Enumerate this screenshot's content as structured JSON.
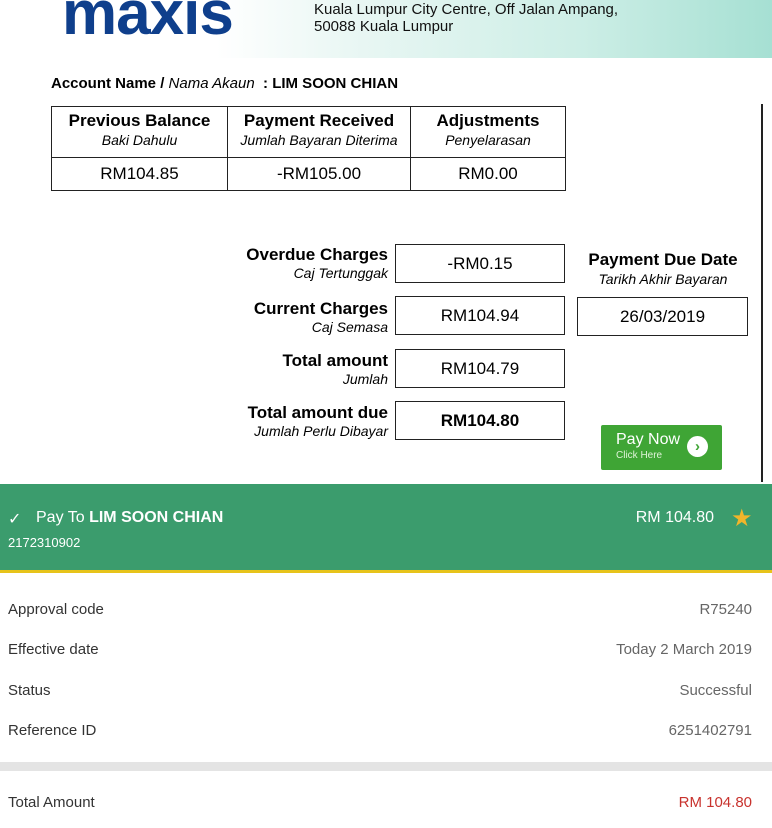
{
  "bill": {
    "logo": "maxis",
    "address_line1": "Kuala Lumpur City Centre, Off Jalan Ampang,",
    "address_line2": "50088 Kuala Lumpur",
    "account_label_en": "Account Name /",
    "account_label_ms": "Nama Akaun",
    "account_name": ": LIM SOON CHIAN",
    "balance_table": [
      {
        "title": "Previous Balance",
        "subtitle": "Baki Dahulu",
        "value": "RM104.85"
      },
      {
        "title": "Payment Received",
        "subtitle": "Jumlah Bayaran Diterima",
        "value": "-RM105.00"
      },
      {
        "title": "Adjustments",
        "subtitle": "Penyelarasan",
        "value": "RM0.00"
      }
    ],
    "charges": [
      {
        "title": "Overdue Charges",
        "subtitle": "Caj Tertunggak",
        "value": "-RM0.15"
      },
      {
        "title": "Current Charges",
        "subtitle": "Caj Semasa",
        "value": "RM104.94"
      },
      {
        "title": "Total amount",
        "subtitle": "Jumlah",
        "value": "RM104.79"
      },
      {
        "title": "Total amount due",
        "subtitle": "Jumlah Perlu Dibayar",
        "value": "RM104.80"
      }
    ],
    "due_date_title": "Payment Due Date",
    "due_date_subtitle": "Tarikh Akhir Bayaran",
    "due_date": "26/03/2019",
    "pay_now_label": "Pay Now",
    "pay_now_sub": "Click Here",
    "pay_now_icon": "chevron-right-icon"
  },
  "receipt": {
    "pay_to_prefix": "Pay To",
    "payee": "LIM SOON CHIAN",
    "account_number": "2172310902",
    "amount": "RM 104.80",
    "favourite_icon": "star-icon",
    "accent_color": "#3b9c6d",
    "details": [
      {
        "label": "Approval code",
        "value": "R75240"
      },
      {
        "label": "Effective date",
        "value": "Today 2 March 2019"
      },
      {
        "label": "Status",
        "value": "Successful"
      },
      {
        "label": "Reference ID",
        "value": "6251402791"
      }
    ],
    "total_label": "Total Amount",
    "total_value": "RM 104.80"
  }
}
